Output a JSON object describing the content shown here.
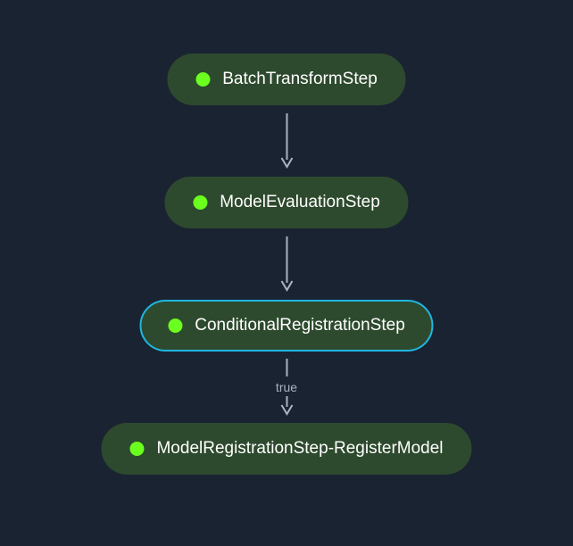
{
  "pipeline": {
    "steps": [
      {
        "label": "BatchTransformStep",
        "status": "success",
        "selected": false
      },
      {
        "label": "ModelEvaluationStep",
        "status": "success",
        "selected": false
      },
      {
        "label": "ConditionalRegistrationStep",
        "status": "success",
        "selected": true
      },
      {
        "label": "ModelRegistrationStep-RegisterModel",
        "status": "success",
        "selected": false
      }
    ],
    "edges": [
      {
        "label": ""
      },
      {
        "label": ""
      },
      {
        "label": "true"
      }
    ]
  },
  "colors": {
    "bg": "#1a2332",
    "node": "#2e4a2e",
    "selectedBorder": "#1fb6e0",
    "statusSuccess": "#6aff1e",
    "edge": "#aab4c0",
    "text": "#ffffff"
  }
}
